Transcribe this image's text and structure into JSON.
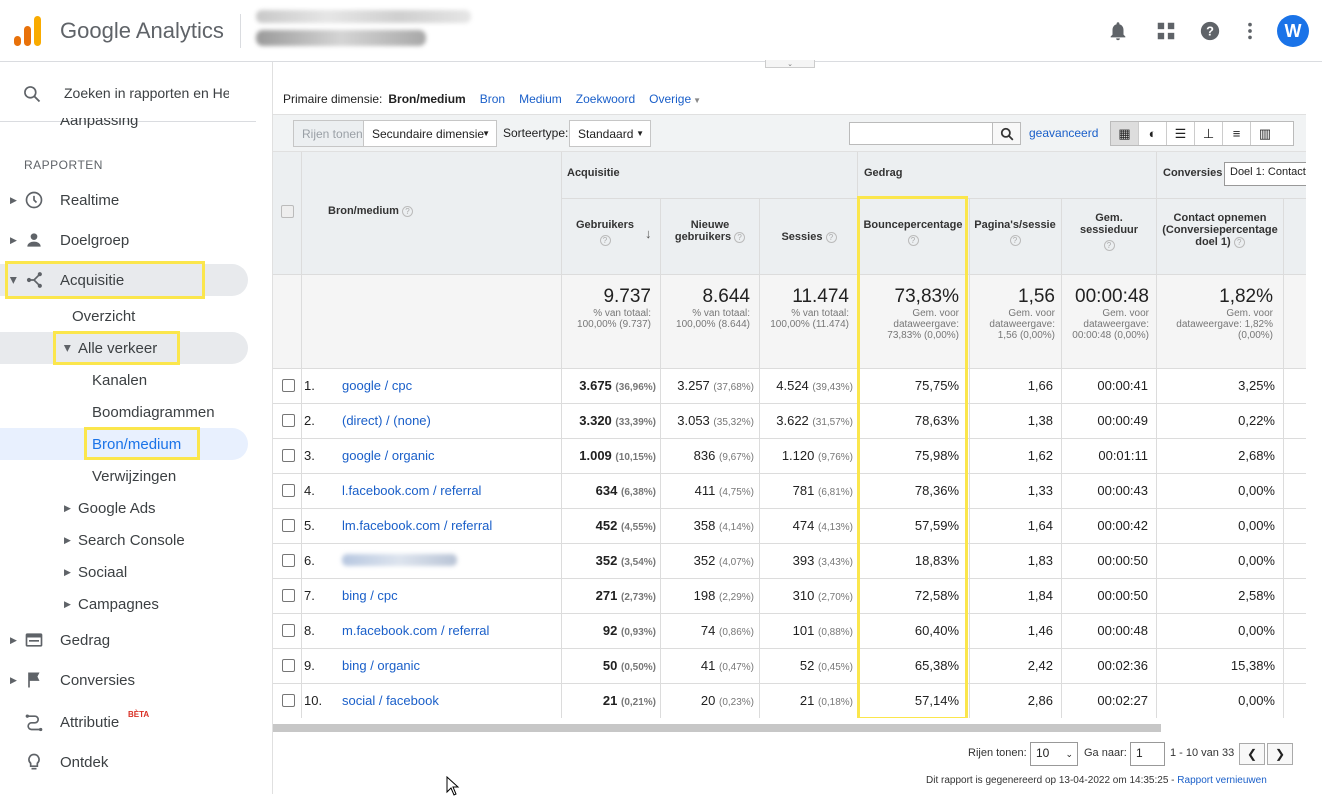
{
  "app": {
    "brand": "Google Analytics",
    "avatar_letter": "W",
    "brand_color": "#1a73e8"
  },
  "sidebar": {
    "search_placeholder": "Zoeken in rapporten en Help",
    "cut_item": "Aanpassing",
    "section": "RAPPORTEN",
    "items": [
      {
        "label": "Realtime",
        "icon": "clock-icon"
      },
      {
        "label": "Doelgroep",
        "icon": "person-icon"
      },
      {
        "label": "Acquisitie",
        "icon": "acquisition-icon"
      },
      {
        "label": "Overzicht"
      },
      {
        "label": "Alle verkeer"
      },
      {
        "label": "Kanalen"
      },
      {
        "label": "Boomdiagrammen"
      },
      {
        "label": "Bron/medium"
      },
      {
        "label": "Verwijzingen"
      },
      {
        "label": "Google Ads"
      },
      {
        "label": "Search Console"
      },
      {
        "label": "Sociaal"
      },
      {
        "label": "Campagnes"
      },
      {
        "label": "Gedrag",
        "icon": "behavior-icon"
      },
      {
        "label": "Conversies",
        "icon": "flag-icon"
      },
      {
        "label": "Attributie",
        "badge": "BÈTA",
        "icon": "attribution-icon"
      },
      {
        "label": "Ontdek",
        "icon": "lightbulb-icon"
      }
    ]
  },
  "primary_dim": {
    "label": "Primaire dimensie:",
    "active": "Bron/medium",
    "options": [
      "Bron",
      "Medium",
      "Zoekwoord",
      "Overige"
    ]
  },
  "toolbar": {
    "show_rows": "Rijen tonen",
    "secondary_dim": "Secundaire dimensie",
    "sort_label": "Sorteertype:",
    "sort_value": "Standaard",
    "advanced": "geavanceerd"
  },
  "table": {
    "group_acq": "Acquisitie",
    "group_beh": "Gedrag",
    "group_conv": "Conversies",
    "conv_select": "Doel 1: Contact",
    "col_dim": "Bron/medium",
    "cols": [
      "Gebruikers",
      "Nieuwe gebruikers",
      "Sessies",
      "Bouncepercentage",
      "Pagina's/sessie",
      "Gem. sessieduur",
      "Contact opnemen (Conversiepercentage doel 1)"
    ],
    "totals": [
      {
        "value": "9.737",
        "sub": "% van totaal: 100,00% (9.737)"
      },
      {
        "value": "8.644",
        "sub": "% van totaal: 100,00% (8.644)"
      },
      {
        "value": "11.474",
        "sub": "% van totaal: 100,00% (11.474)"
      },
      {
        "value": "73,83%",
        "sub": "Gem. voor dataweergave: 73,83% (0,00%)"
      },
      {
        "value": "1,56",
        "sub": "Gem. voor dataweergave: 1,56 (0,00%)"
      },
      {
        "value": "00:00:48",
        "sub": "Gem. voor dataweergave: 00:00:48 (0,00%)"
      },
      {
        "value": "1,82%",
        "sub": "Gem. voor dataweergave: 1,82% (0,00%)"
      }
    ],
    "rows": [
      {
        "n": "1.",
        "src": "google / cpc",
        "u": "3.675",
        "up": "(36,96%)",
        "nu": "3.257",
        "nup": "(37,68%)",
        "s": "4.524",
        "sp": "(39,43%)",
        "b": "75,75%",
        "p": "1,66",
        "d": "00:00:41",
        "c": "3,25%"
      },
      {
        "n": "2.",
        "src": "(direct) / (none)",
        "u": "3.320",
        "up": "(33,39%)",
        "nu": "3.053",
        "nup": "(35,32%)",
        "s": "3.622",
        "sp": "(31,57%)",
        "b": "78,63%",
        "p": "1,38",
        "d": "00:00:49",
        "c": "0,22%"
      },
      {
        "n": "3.",
        "src": "google / organic",
        "u": "1.009",
        "up": "(10,15%)",
        "nu": "836",
        "nup": "(9,67%)",
        "s": "1.120",
        "sp": "(9,76%)",
        "b": "75,98%",
        "p": "1,62",
        "d": "00:01:11",
        "c": "2,68%"
      },
      {
        "n": "4.",
        "src": "l.facebook.com / referral",
        "u": "634",
        "up": "(6,38%)",
        "nu": "411",
        "nup": "(4,75%)",
        "s": "781",
        "sp": "(6,81%)",
        "b": "78,36%",
        "p": "1,33",
        "d": "00:00:43",
        "c": "0,00%"
      },
      {
        "n": "5.",
        "src": "lm.facebook.com / referral",
        "u": "452",
        "up": "(4,55%)",
        "nu": "358",
        "nup": "(4,14%)",
        "s": "474",
        "sp": "(4,13%)",
        "b": "57,59%",
        "p": "1,64",
        "d": "00:00:42",
        "c": "0,00%"
      },
      {
        "n": "6.",
        "src": "",
        "u": "352",
        "up": "(3,54%)",
        "nu": "352",
        "nup": "(4,07%)",
        "s": "393",
        "sp": "(3,43%)",
        "b": "18,83%",
        "p": "1,83",
        "d": "00:00:50",
        "c": "0,00%"
      },
      {
        "n": "7.",
        "src": "bing / cpc",
        "u": "271",
        "up": "(2,73%)",
        "nu": "198",
        "nup": "(2,29%)",
        "s": "310",
        "sp": "(2,70%)",
        "b": "72,58%",
        "p": "1,84",
        "d": "00:00:50",
        "c": "2,58%"
      },
      {
        "n": "8.",
        "src": "m.facebook.com / referral",
        "u": "92",
        "up": "(0,93%)",
        "nu": "74",
        "nup": "(0,86%)",
        "s": "101",
        "sp": "(0,88%)",
        "b": "60,40%",
        "p": "1,46",
        "d": "00:00:48",
        "c": "0,00%"
      },
      {
        "n": "9.",
        "src": "bing / organic",
        "u": "50",
        "up": "(0,50%)",
        "nu": "41",
        "nup": "(0,47%)",
        "s": "52",
        "sp": "(0,45%)",
        "b": "65,38%",
        "p": "2,42",
        "d": "00:02:36",
        "c": "15,38%"
      },
      {
        "n": "10.",
        "src": "social / facebook",
        "u": "21",
        "up": "(0,21%)",
        "nu": "20",
        "nup": "(0,23%)",
        "s": "21",
        "sp": "(0,18%)",
        "b": "57,14%",
        "p": "2,86",
        "d": "00:02:27",
        "c": "0,00%"
      }
    ]
  },
  "footer": {
    "rows_label": "Rijen tonen:",
    "rows_value": "10",
    "goto_label": "Ga naar:",
    "goto_value": "1",
    "range": "1 - 10 van 33",
    "generated": "Dit rapport is gegenereerd op 13-04-2022 om 14:35:25 - ",
    "refresh": "Rapport vernieuwen"
  },
  "highlight_color": "#fbe64c"
}
